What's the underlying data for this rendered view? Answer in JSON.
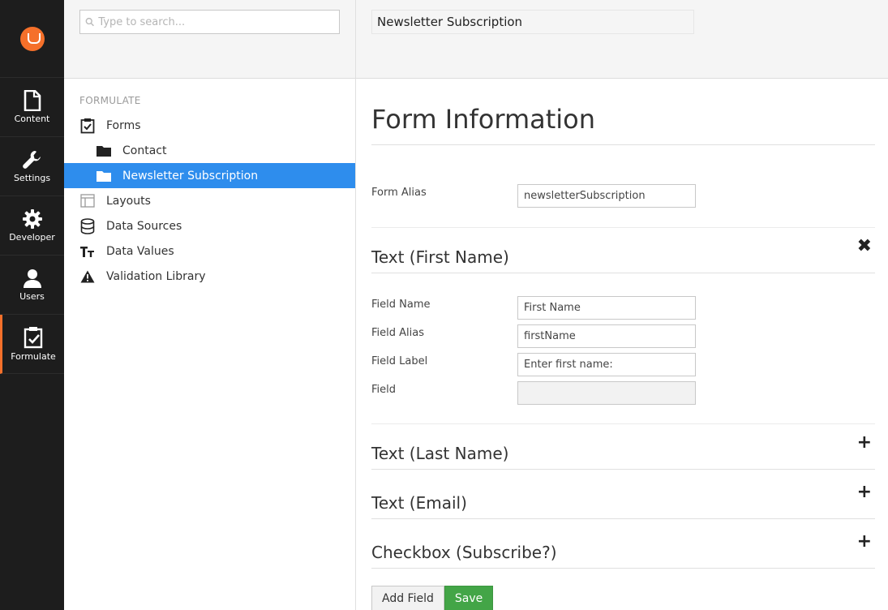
{
  "app_nav": [
    {
      "label": "Content",
      "icon": "document-icon"
    },
    {
      "label": "Settings",
      "icon": "wrench-icon"
    },
    {
      "label": "Developer",
      "icon": "gear-icon"
    },
    {
      "label": "Users",
      "icon": "user-icon"
    },
    {
      "label": "Formulate",
      "icon": "clipboard-check-icon",
      "active": true
    }
  ],
  "brand": {
    "accent": "#f5702a",
    "selected": "#2e8ded",
    "save": "#43a547"
  },
  "tree": {
    "search_placeholder": "Type to search...",
    "section_title": "FORMULATE",
    "items": [
      {
        "label": "Forms",
        "icon": "clipboard-check-icon"
      },
      {
        "label": "Contact",
        "icon": "folder-icon"
      },
      {
        "label": "Newsletter Subscription",
        "icon": "folder-icon",
        "selected": true
      },
      {
        "label": "Layouts",
        "icon": "layout-icon"
      },
      {
        "label": "Data Sources",
        "icon": "database-icon"
      },
      {
        "label": "Data Values",
        "icon": "text-size-icon"
      },
      {
        "label": "Validation Library",
        "icon": "warning-icon"
      }
    ]
  },
  "main": {
    "name_value": "Newsletter Subscription",
    "page_title": "Form Information",
    "form_alias": {
      "label": "Form Alias",
      "value": "newsletterSubscription"
    },
    "fields": [
      {
        "title": "Text (First Name)",
        "control": "✖",
        "expanded": true,
        "properties": [
          {
            "label": "Field Name",
            "value": "First Name"
          },
          {
            "label": "Field Alias",
            "value": "firstName"
          },
          {
            "label": "Field Label",
            "value": "Enter first name:"
          },
          {
            "label": "Field",
            "value": ""
          }
        ]
      },
      {
        "title": "Text (Last Name)",
        "control": "+"
      },
      {
        "title": "Text (Email)",
        "control": "+"
      },
      {
        "title": "Checkbox (Subscribe?)",
        "control": "+"
      }
    ],
    "add_field_label": "Add Field",
    "save_label": "Save"
  }
}
